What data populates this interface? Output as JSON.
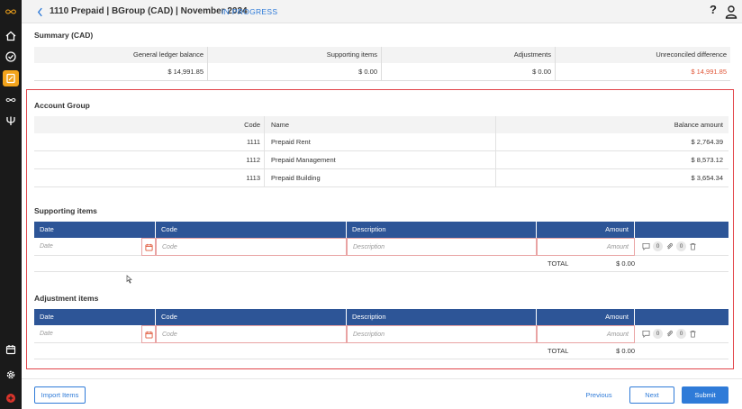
{
  "header": {
    "title": "1110 Prepaid | BGroup (CAD) | November 2024",
    "status": "IN PROGRESS",
    "help_label": "?"
  },
  "summary": {
    "title": "Summary (CAD)",
    "columns": [
      "General ledger balance",
      "Supporting items",
      "Adjustments",
      "Unreconciled difference"
    ],
    "values": [
      "$ 14,991.85",
      "$ 0.00",
      "$ 0.00",
      "$ 14,991.85"
    ]
  },
  "account_group": {
    "title": "Account Group",
    "columns": [
      "Code",
      "Name",
      "Balance amount"
    ],
    "rows": [
      [
        "1111",
        "Prepaid Rent",
        "$ 2,764.39"
      ],
      [
        "1112",
        "Prepaid Management",
        "$ 8,573.12"
      ],
      [
        "1113",
        "Prepaid Building",
        "$ 3,654.34"
      ]
    ]
  },
  "supporting_items": {
    "title": "Supporting items",
    "columns": [
      "Date",
      "Code",
      "Description",
      "Amount"
    ],
    "placeholders": {
      "date": "Date",
      "code": "Code",
      "description": "Description",
      "amount": "Amount"
    },
    "comment_count": "0",
    "attachment_count": "0",
    "total_label": "TOTAL",
    "total_value": "$ 0.00"
  },
  "adjustment_items": {
    "title": "Adjustment items",
    "columns": [
      "Date",
      "Code",
      "Description",
      "Amount"
    ],
    "placeholders": {
      "date": "Date",
      "code": "Code",
      "description": "Description",
      "amount": "Amount"
    },
    "comment_count": "0",
    "attachment_count": "0",
    "total_label": "TOTAL",
    "total_value": "$ 0.00"
  },
  "footer": {
    "import_label": "Import Items",
    "previous_label": "Previous",
    "next_label": "Next",
    "submit_label": "Submit"
  },
  "colors": {
    "accent": "#2f7bd8",
    "table_header": "#2d5597",
    "rail": "#1a1a1a",
    "active_rail_item": "#f2a31b",
    "negative": "#e0583a",
    "outline": "#e2454a"
  },
  "rail_icons": [
    "infinity-logo-icon",
    "home-icon",
    "check-circle-icon",
    "reconciliation-icon",
    "infinity-icon",
    "trident-icon",
    "calendar-icon",
    "gear-icon",
    "brand-icon"
  ]
}
